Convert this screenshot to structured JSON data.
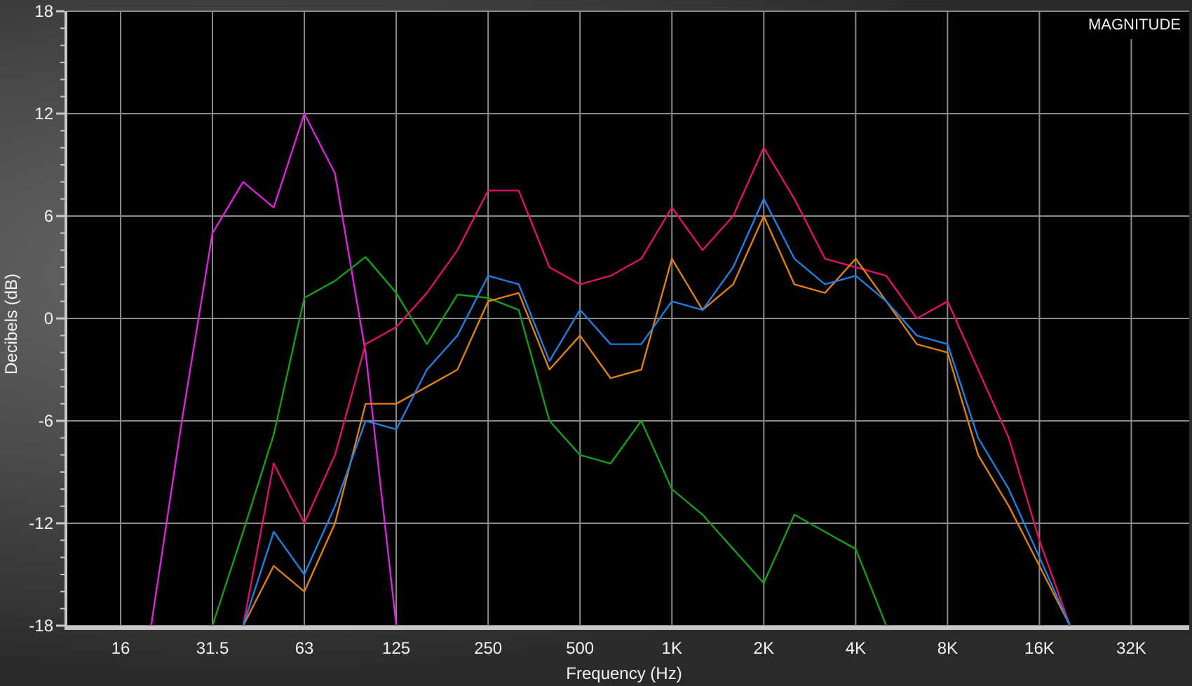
{
  "chart_data": {
    "type": "line",
    "title": "MAGNITUDE",
    "xlabel": "Frequency (Hz)",
    "ylabel": "Decibels (dB)",
    "categories": [
      "16",
      null,
      null,
      "31.5",
      null,
      null,
      "63",
      null,
      null,
      "125",
      null,
      null,
      "250",
      null,
      null,
      "500",
      null,
      null,
      "1K",
      null,
      null,
      "2K",
      null,
      null,
      "4K",
      null,
      null,
      "8K",
      null,
      null,
      "16K",
      null,
      null,
      "32K"
    ],
    "series": [
      {
        "color": "#e020e0",
        "values": [
          null,
          -18,
          -6,
          5,
          8,
          6.5,
          12,
          8.5,
          -2,
          -18,
          null,
          null,
          null,
          null,
          null,
          null,
          null,
          null,
          null,
          null,
          null,
          null,
          null,
          null,
          null,
          null,
          null,
          null,
          null,
          null,
          null,
          null,
          null,
          null
        ]
      },
      {
        "color": "#14a014",
        "values": [
          null,
          null,
          null,
          -18,
          -12.5,
          -6.8,
          1.2,
          2.2,
          3.6,
          1.5,
          -1.5,
          1.4,
          1.2,
          0.5,
          -6,
          -8,
          -8.5,
          -6,
          -10,
          -11.5,
          -13.5,
          -15.5,
          -11.5,
          -12.5,
          -13.5,
          -18,
          null,
          null,
          null,
          null,
          null,
          null,
          null,
          null
        ]
      },
      {
        "color": "#e0106a",
        "values": [
          null,
          null,
          null,
          null,
          -18,
          -8.5,
          -12,
          -8,
          -1.5,
          -0.5,
          1.5,
          4,
          7.5,
          7.5,
          3,
          2,
          2.5,
          3.5,
          6.5,
          4,
          6,
          10,
          7,
          3.5,
          3,
          2.5,
          0,
          1,
          -3,
          -7,
          -13,
          -18,
          null,
          null
        ]
      },
      {
        "color": "#e08010",
        "values": [
          null,
          null,
          null,
          null,
          -18,
          -14.5,
          -16,
          -12,
          -5,
          -5,
          -4,
          -3,
          1,
          1.5,
          -3,
          -1,
          -3.5,
          -3,
          3.5,
          0.5,
          2,
          6,
          2,
          1.5,
          3.5,
          1,
          -1.5,
          -2,
          -8,
          -11,
          -14.5,
          -18,
          null,
          null
        ]
      },
      {
        "color": "#1e80e0",
        "values": [
          null,
          null,
          null,
          null,
          -18,
          -12.5,
          -15,
          -11,
          -6,
          -6.5,
          -3,
          -1,
          2.5,
          2,
          -2.5,
          0.5,
          -1.5,
          -1.5,
          1,
          0.5,
          3,
          7,
          3.5,
          2,
          2.5,
          1,
          -1,
          -1.5,
          -7,
          -10,
          -14,
          -18,
          null,
          null
        ]
      }
    ],
    "ylim": [
      -18,
      18
    ],
    "grid": true,
    "yticks": [
      18,
      12,
      6,
      0,
      -6,
      -12,
      -18
    ]
  }
}
